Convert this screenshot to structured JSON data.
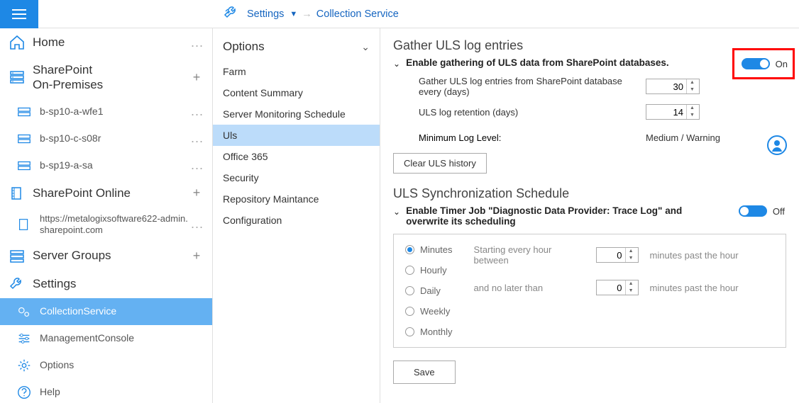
{
  "breadcrumb": {
    "settings": "Settings",
    "current": "Collection Service"
  },
  "sidebar": {
    "home": "Home",
    "sp_onprem": "SharePoint\nOn-Premises",
    "server1": "b-sp10-a-wfe1",
    "server2": "b-sp10-c-s08r",
    "server3": "b-sp19-a-sa",
    "sp_online": "SharePoint Online",
    "online_url": "https://metalogixsoftware622-admin.sharepoint.com",
    "server_groups": "Server Groups",
    "settings": "Settings",
    "collection_service": "CollectionService",
    "mgmt_console": "ManagementConsole",
    "options": "Options",
    "help": "Help"
  },
  "options": {
    "header": "Options",
    "items": [
      "Farm",
      "Content Summary",
      "Server Monitoring Schedule",
      "Uls",
      "Office 365",
      "Security",
      "Repository Maintance",
      "Configuration"
    ]
  },
  "content": {
    "gather_title": "Gather ULS log entries",
    "gather_enable": "Enable gathering of ULS data from SharePoint databases.",
    "gather_every_label": "Gather ULS log entries from SharePoint database every (days)",
    "gather_every_value": "30",
    "retention_label": "ULS log retention (days)",
    "retention_value": "14",
    "min_log_label": "Minimum Log Level:",
    "min_log_value": "Medium / Warning",
    "clear_btn": "Clear ULS history",
    "sync_title": "ULS Synchronization Schedule",
    "sync_enable": "Enable Timer Job \"Diagnostic Data Provider: Trace Log\" and overwrite its scheduling",
    "toggle_on": "On",
    "toggle_off": "Off",
    "radios": [
      "Minutes",
      "Hourly",
      "Daily",
      "Weekly",
      "Monthly"
    ],
    "sched_start_label": "Starting every hour between",
    "sched_start_value": "0",
    "sched_end_label": "and no later than",
    "sched_end_value": "0",
    "sched_suffix": "minutes past the hour",
    "save_btn": "Save"
  }
}
